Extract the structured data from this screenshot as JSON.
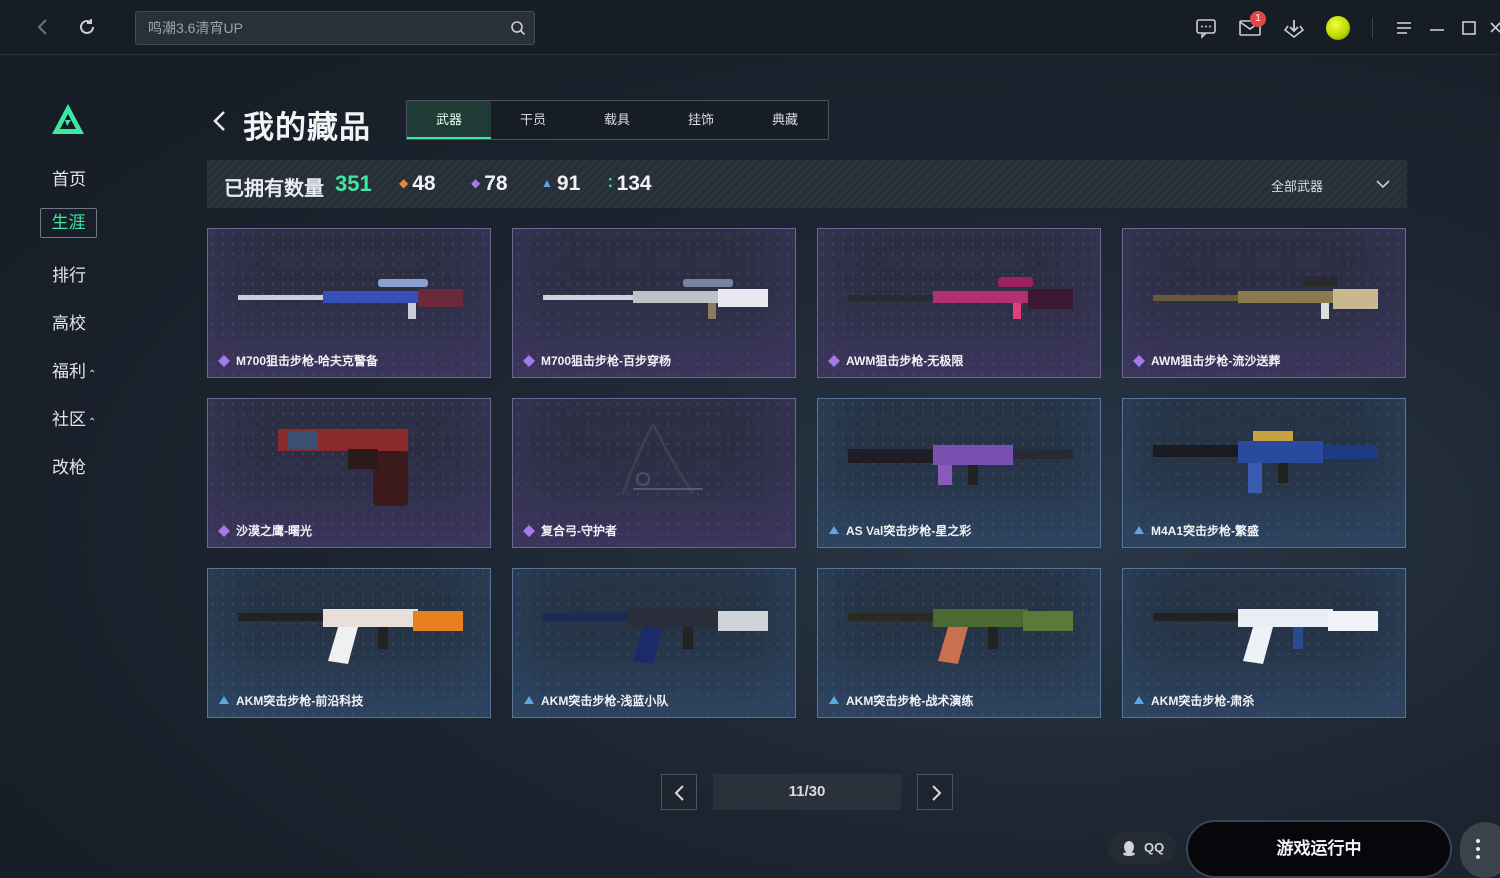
{
  "topbar": {
    "search_placeholder": "鸣潮3.6清宵UP",
    "mail_badge": "1"
  },
  "sidebar": {
    "items": [
      {
        "label": "首页"
      },
      {
        "label": "生涯"
      },
      {
        "label": "排行"
      },
      {
        "label": "高校"
      },
      {
        "label": "福利"
      },
      {
        "label": "社区"
      },
      {
        "label": "改枪"
      }
    ]
  },
  "header": {
    "title": "我的藏品",
    "tabs": [
      "武器",
      "干员",
      "载具",
      "挂饰",
      "典藏"
    ]
  },
  "stats": {
    "label": "已拥有数量",
    "total": "351",
    "rarity_counts": [
      {
        "value": "48",
        "color": "#e08a3c"
      },
      {
        "value": "78",
        "color": "#a679e8"
      },
      {
        "value": "91",
        "color": "#5aa7e8"
      },
      {
        "value": "134",
        "color": "#3ee8a0"
      }
    ],
    "filter_label": "全部武器"
  },
  "items": [
    {
      "name": "M700狙击步枪-哈夫克警备",
      "rarity": "purple"
    },
    {
      "name": "M700狙击步枪-百步穿杨",
      "rarity": "purple"
    },
    {
      "name": "AWM狙击步枪-无极限",
      "rarity": "purple"
    },
    {
      "name": "AWM狙击步枪-流沙送葬",
      "rarity": "purple"
    },
    {
      "name": "沙漠之鹰-曙光",
      "rarity": "purple"
    },
    {
      "name": "复合弓-守护者",
      "rarity": "purple"
    },
    {
      "name": "AS Val突击步枪-星之彩",
      "rarity": "blue"
    },
    {
      "name": "M4A1突击步枪-繁盛",
      "rarity": "blue"
    },
    {
      "name": "AKM突击步枪-前沿科技",
      "rarity": "blue"
    },
    {
      "name": "AKM突击步枪-浅蓝小队",
      "rarity": "blue"
    },
    {
      "name": "AKM突击步枪-战术演练",
      "rarity": "blue"
    },
    {
      "name": "AKM突击步枪-肃杀",
      "rarity": "blue"
    }
  ],
  "pagination": {
    "page": "11/30"
  },
  "footer": {
    "qq_label": "QQ",
    "run_label": "游戏运行中"
  }
}
